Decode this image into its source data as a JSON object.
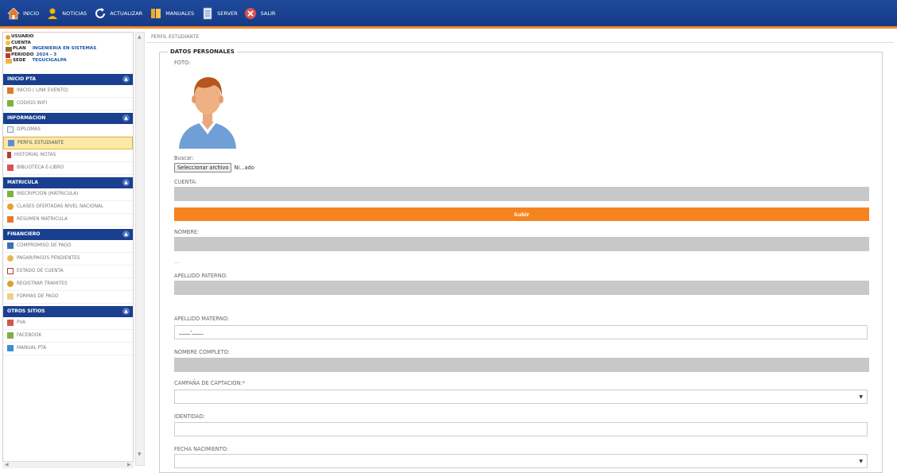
{
  "topnav": [
    {
      "label": "INICIO",
      "icon": "home-icon",
      "color": "#e07b2a"
    },
    {
      "label": "NOTICIAS",
      "icon": "person-icon",
      "color": "#f4b400"
    },
    {
      "label": "ACTUALIZAR",
      "icon": "refresh-icon",
      "color": "#ffffff"
    },
    {
      "label": "MANUALES",
      "icon": "book-icon",
      "color": "#f5a623"
    },
    {
      "label": "SERVER",
      "icon": "document-icon",
      "color": "#dfe7f5"
    },
    {
      "label": "SALIR",
      "icon": "close-icon",
      "color": "#d9534f"
    }
  ],
  "userinfo": {
    "usuario_label": "USUARIO",
    "cuenta_label": "CUENTA",
    "plan_label": "PLAN",
    "plan_value": "INGENIERIA EN SISTEMAS",
    "periodo_label": "PERIODO",
    "periodo_value": "2024 - 3",
    "sede_label": "SEDE",
    "sede_value": "TEGUCIGALPA"
  },
  "sidebar": {
    "sections": [
      {
        "title": "INICIO PTA",
        "items": [
          {
            "label": "INICIO ( LINK EVENTO)",
            "icon": "home-icon"
          },
          {
            "label": "CODIGO WIFI",
            "icon": "wifi-icon"
          }
        ]
      },
      {
        "title": "INFORMACION",
        "items": [
          {
            "label": "DIPLOMAS",
            "icon": "diploma-icon"
          },
          {
            "label": "PERFIL ESTUDIANTE",
            "icon": "profile-icon",
            "active": true
          },
          {
            "label": "HISTORIAL NOTAS",
            "icon": "grades-icon"
          },
          {
            "label": "BIBLIOTECA E-LIBRO",
            "icon": "library-icon"
          }
        ]
      },
      {
        "title": "MATRICULA",
        "items": [
          {
            "label": "INSCRIPCION (MATRICULA)",
            "icon": "enroll-icon"
          },
          {
            "label": "CLASES OFERTADAS NIVEL NACIONAL",
            "icon": "classes-icon"
          },
          {
            "label": "RESUMEN MATRICULA",
            "icon": "summary-icon"
          }
        ]
      },
      {
        "title": "FINANCIERO",
        "items": [
          {
            "label": "COMPROMISO DE PAGO",
            "icon": "payment-icon"
          },
          {
            "label": "PAGAR/PAGOS PENDIENTES",
            "icon": "coins-icon"
          },
          {
            "label": "ESTADO DE CUENTA",
            "icon": "chart-icon"
          },
          {
            "label": "REGISTRAR TRAMITES",
            "icon": "register-icon"
          },
          {
            "label": "FORMAS DE PAGO",
            "icon": "forms-icon"
          }
        ]
      },
      {
        "title": "OTROS SITIOS",
        "items": [
          {
            "label": "PVA",
            "icon": "pva-icon"
          },
          {
            "label": "FACEBOOK",
            "icon": "facebook-icon"
          },
          {
            "label": "MANUAL PTA",
            "icon": "manual-icon"
          }
        ]
      }
    ]
  },
  "breadcrumb": "PERFIL ESTUDIANTE",
  "form": {
    "legend": "DATOS PERSONALES",
    "foto_label": "FOTO:",
    "buscar_label": "Buscar:",
    "file_button": "Seleccionar archivo",
    "file_status": "Ni...ado",
    "cuenta_label": "CUENTA:",
    "subir_button": "Subir",
    "nombre_label": "NOMBRE:",
    "ellipsis": "...",
    "apellido_paterno_label": "APELLIDO PATERNO:",
    "apellido_materno_label": "APELLIDO MATERNO:",
    "apellido_materno_value": "____-____",
    "nombre_completo_label": "NOMBRE COMPLETO:",
    "campana_label": "CAMPAÑA DE CAPTACION:*",
    "identidad_label": "IDENTIDAD:",
    "fecha_nacimiento_label": "FECHA NACIMIENTO:"
  }
}
